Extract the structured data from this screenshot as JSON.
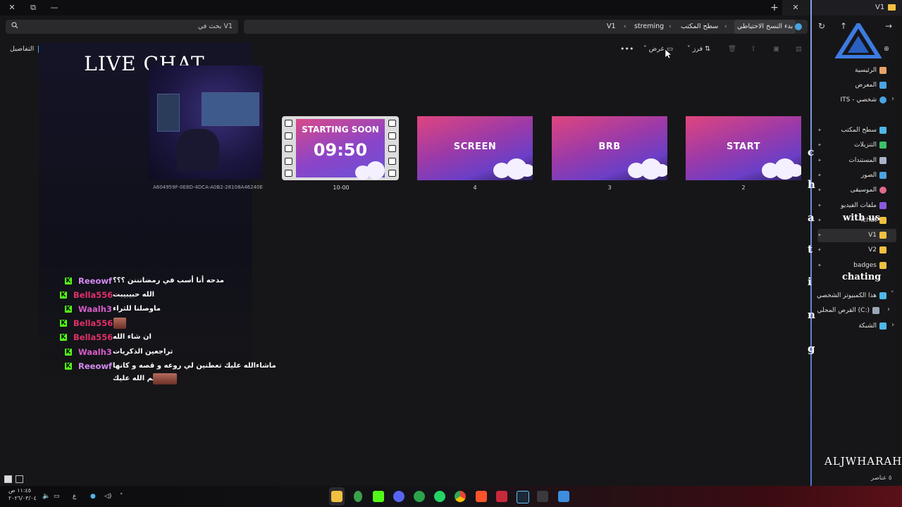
{
  "window": {
    "tab_title": "V1",
    "new_tab": "+",
    "close_tab": "✕",
    "controls": {
      "close": "✕",
      "restore": "⧉",
      "minimize": "—"
    }
  },
  "search": {
    "placeholder": "بحث في V1"
  },
  "breadcrumbs": [
    {
      "label": "بدء النسخ الاحتياطي"
    },
    {
      "label": "سطح المكتب"
    },
    {
      "label": "streming"
    },
    {
      "label": "V1"
    }
  ],
  "toolbar": {
    "details": "التفاصيل",
    "view": "عرض",
    "sort": "فرز",
    "more": "•••"
  },
  "sidebar": {
    "top": [
      {
        "label": "الرئيسية",
        "icon": "home-icon",
        "color": "#e8a36a"
      },
      {
        "label": "المعرض",
        "icon": "gallery-icon",
        "color": "#4aa3e0"
      },
      {
        "label": "ITS - شخصي",
        "icon": "cloud-icon",
        "color": "#4aa3e0"
      }
    ],
    "pinned": [
      {
        "label": "سطح المكتب",
        "icon": "desktop-icon",
        "color": "#4fb6e8"
      },
      {
        "label": "التنزيلات",
        "icon": "download-icon",
        "color": "#3cc06a"
      },
      {
        "label": "المستندات",
        "icon": "document-icon",
        "color": "#a9b4c8"
      },
      {
        "label": "الصور",
        "icon": "pictures-icon",
        "color": "#4aa3e0"
      },
      {
        "label": "الموسيقى",
        "icon": "music-icon",
        "color": "#e06a8a"
      },
      {
        "label": "ملفات الفيديو",
        "icon": "video-icon",
        "color": "#8a5ae0"
      },
      {
        "label": "ichat",
        "icon": "folder-icon",
        "color": "#f0c040"
      },
      {
        "label": "V1",
        "icon": "folder-icon",
        "color": "#f0c040"
      },
      {
        "label": "V2",
        "icon": "folder-icon",
        "color": "#f0c040"
      },
      {
        "label": "badges",
        "icon": "folder-icon",
        "color": "#f0c040"
      }
    ],
    "bottom": [
      {
        "label": "هذا الكمبيوتر الشخصي",
        "icon": "pc-icon",
        "color": "#4fb6e8"
      },
      {
        "label": "القرص المحلي (C:)",
        "icon": "drive-icon",
        "color": "#9aa6b8"
      },
      {
        "label": "الشبكة",
        "icon": "network-icon",
        "color": "#4fb6e8"
      }
    ],
    "item_count": "٥ عناصر"
  },
  "content": {
    "overlay_title": "LIVE CHAT",
    "files": [
      {
        "caption": "A604959F-0E8D-4DCA-A0B2-28108A46240E"
      },
      {
        "caption": "10-00",
        "title": "STARTING SOON",
        "time": "09:50"
      },
      {
        "caption": "4",
        "label": "SCREEN"
      },
      {
        "caption": "3",
        "label": "BRB"
      },
      {
        "caption": "2",
        "label": "START"
      }
    ]
  },
  "chat": [
    {
      "name": "Reeowf",
      "color": "#d38bf0",
      "msg": "مدحه أنا أسب في رمضانننن ؟؟؟"
    },
    {
      "name": "Bella556",
      "color": "#e0306a",
      "msg": "الله حبيبيبت"
    },
    {
      "name": "Waalh3",
      "color": "#d45cc8",
      "msg": "ماوصلنا للثراء"
    },
    {
      "name": "Bella556",
      "color": "#e0306a",
      "msg": ""
    },
    {
      "name": "Bella556",
      "color": "#e0306a",
      "msg": "ان شاء الله"
    },
    {
      "name": "Waalh3",
      "color": "#d45cc8",
      "msg": "تراجعين الذكريات"
    },
    {
      "name": "Reeowf",
      "color": "#d38bf0",
      "msg": "ماشاءالله عليك تعطنين لي روعه و قصه و كانها"
    },
    {
      "name": "",
      "color": "#ffffff",
      "msg": "بسم الله عليك"
    }
  ],
  "overlay_side": {
    "vertical_letters": [
      "c",
      "h",
      "a",
      "t",
      "i",
      "n",
      "g"
    ],
    "with_us": "with us",
    "chating": "chating",
    "brand": "ALJWHARAH"
  },
  "taskbar": {
    "time": "١١:٤٥ ص",
    "date": "٢٠٢٦/٠٣/٠٤",
    "lang": "ع"
  }
}
